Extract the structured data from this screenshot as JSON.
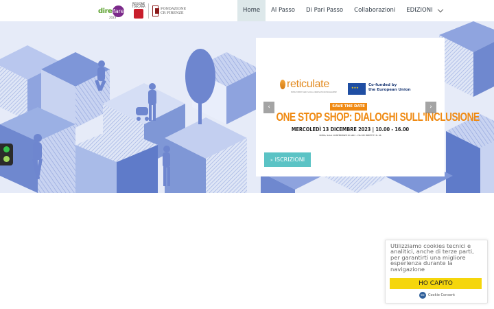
{
  "logos": {
    "direfare_text": "dire",
    "direfare_circle": "fare",
    "direfare_year": "2023",
    "regione_text": "REGIONE TOSCANA",
    "fondazione_text": "FONDAZIONE CR FIRENZE"
  },
  "nav": {
    "items": [
      {
        "label": "Home",
        "active": true
      },
      {
        "label": "Al Passo",
        "active": false
      },
      {
        "label": "Di Pari Passo",
        "active": false
      },
      {
        "label": "Collaborazioni",
        "active": false
      },
      {
        "label": "EDIZIONI",
        "active": false
      }
    ]
  },
  "slide": {
    "brand": "reticulate",
    "brand_sub": "EMPLOYMENT AND SOCIAL INNOVATION PROGRAMME",
    "eu_text_line1": "Co-funded by",
    "eu_text_line2": "the European Union",
    "save_the_date": "SAVE THE DATE",
    "title": "ONE STOP SHOP: DIALOGHI SULL'INCLUSIONE",
    "date": "MERCOLEDÌ 13 DICEMBRE 2023  |  10.00 - 16.00",
    "place": "ROMA, SALA CONFERENZE DI ARCI - VIA DEI PREFETTI N. 46",
    "prev": "‹",
    "next": "›",
    "cta_icon": "»",
    "cta": "ISCRIZIONI"
  },
  "cookie": {
    "text": "Utilizziamo cookies tecnici e analitici, anche di terze parti, per garantirti una migliore esperienza durante la navigazione",
    "button": "HO CAPITO",
    "brand_icon": "cc",
    "brand": "Cookie Consent"
  },
  "colors": {
    "accent_orange": "#ef8a13",
    "cta_teal": "#5bc3c5",
    "cookie_yellow": "#f5d60c",
    "hero_blue": "#7f97d6"
  }
}
